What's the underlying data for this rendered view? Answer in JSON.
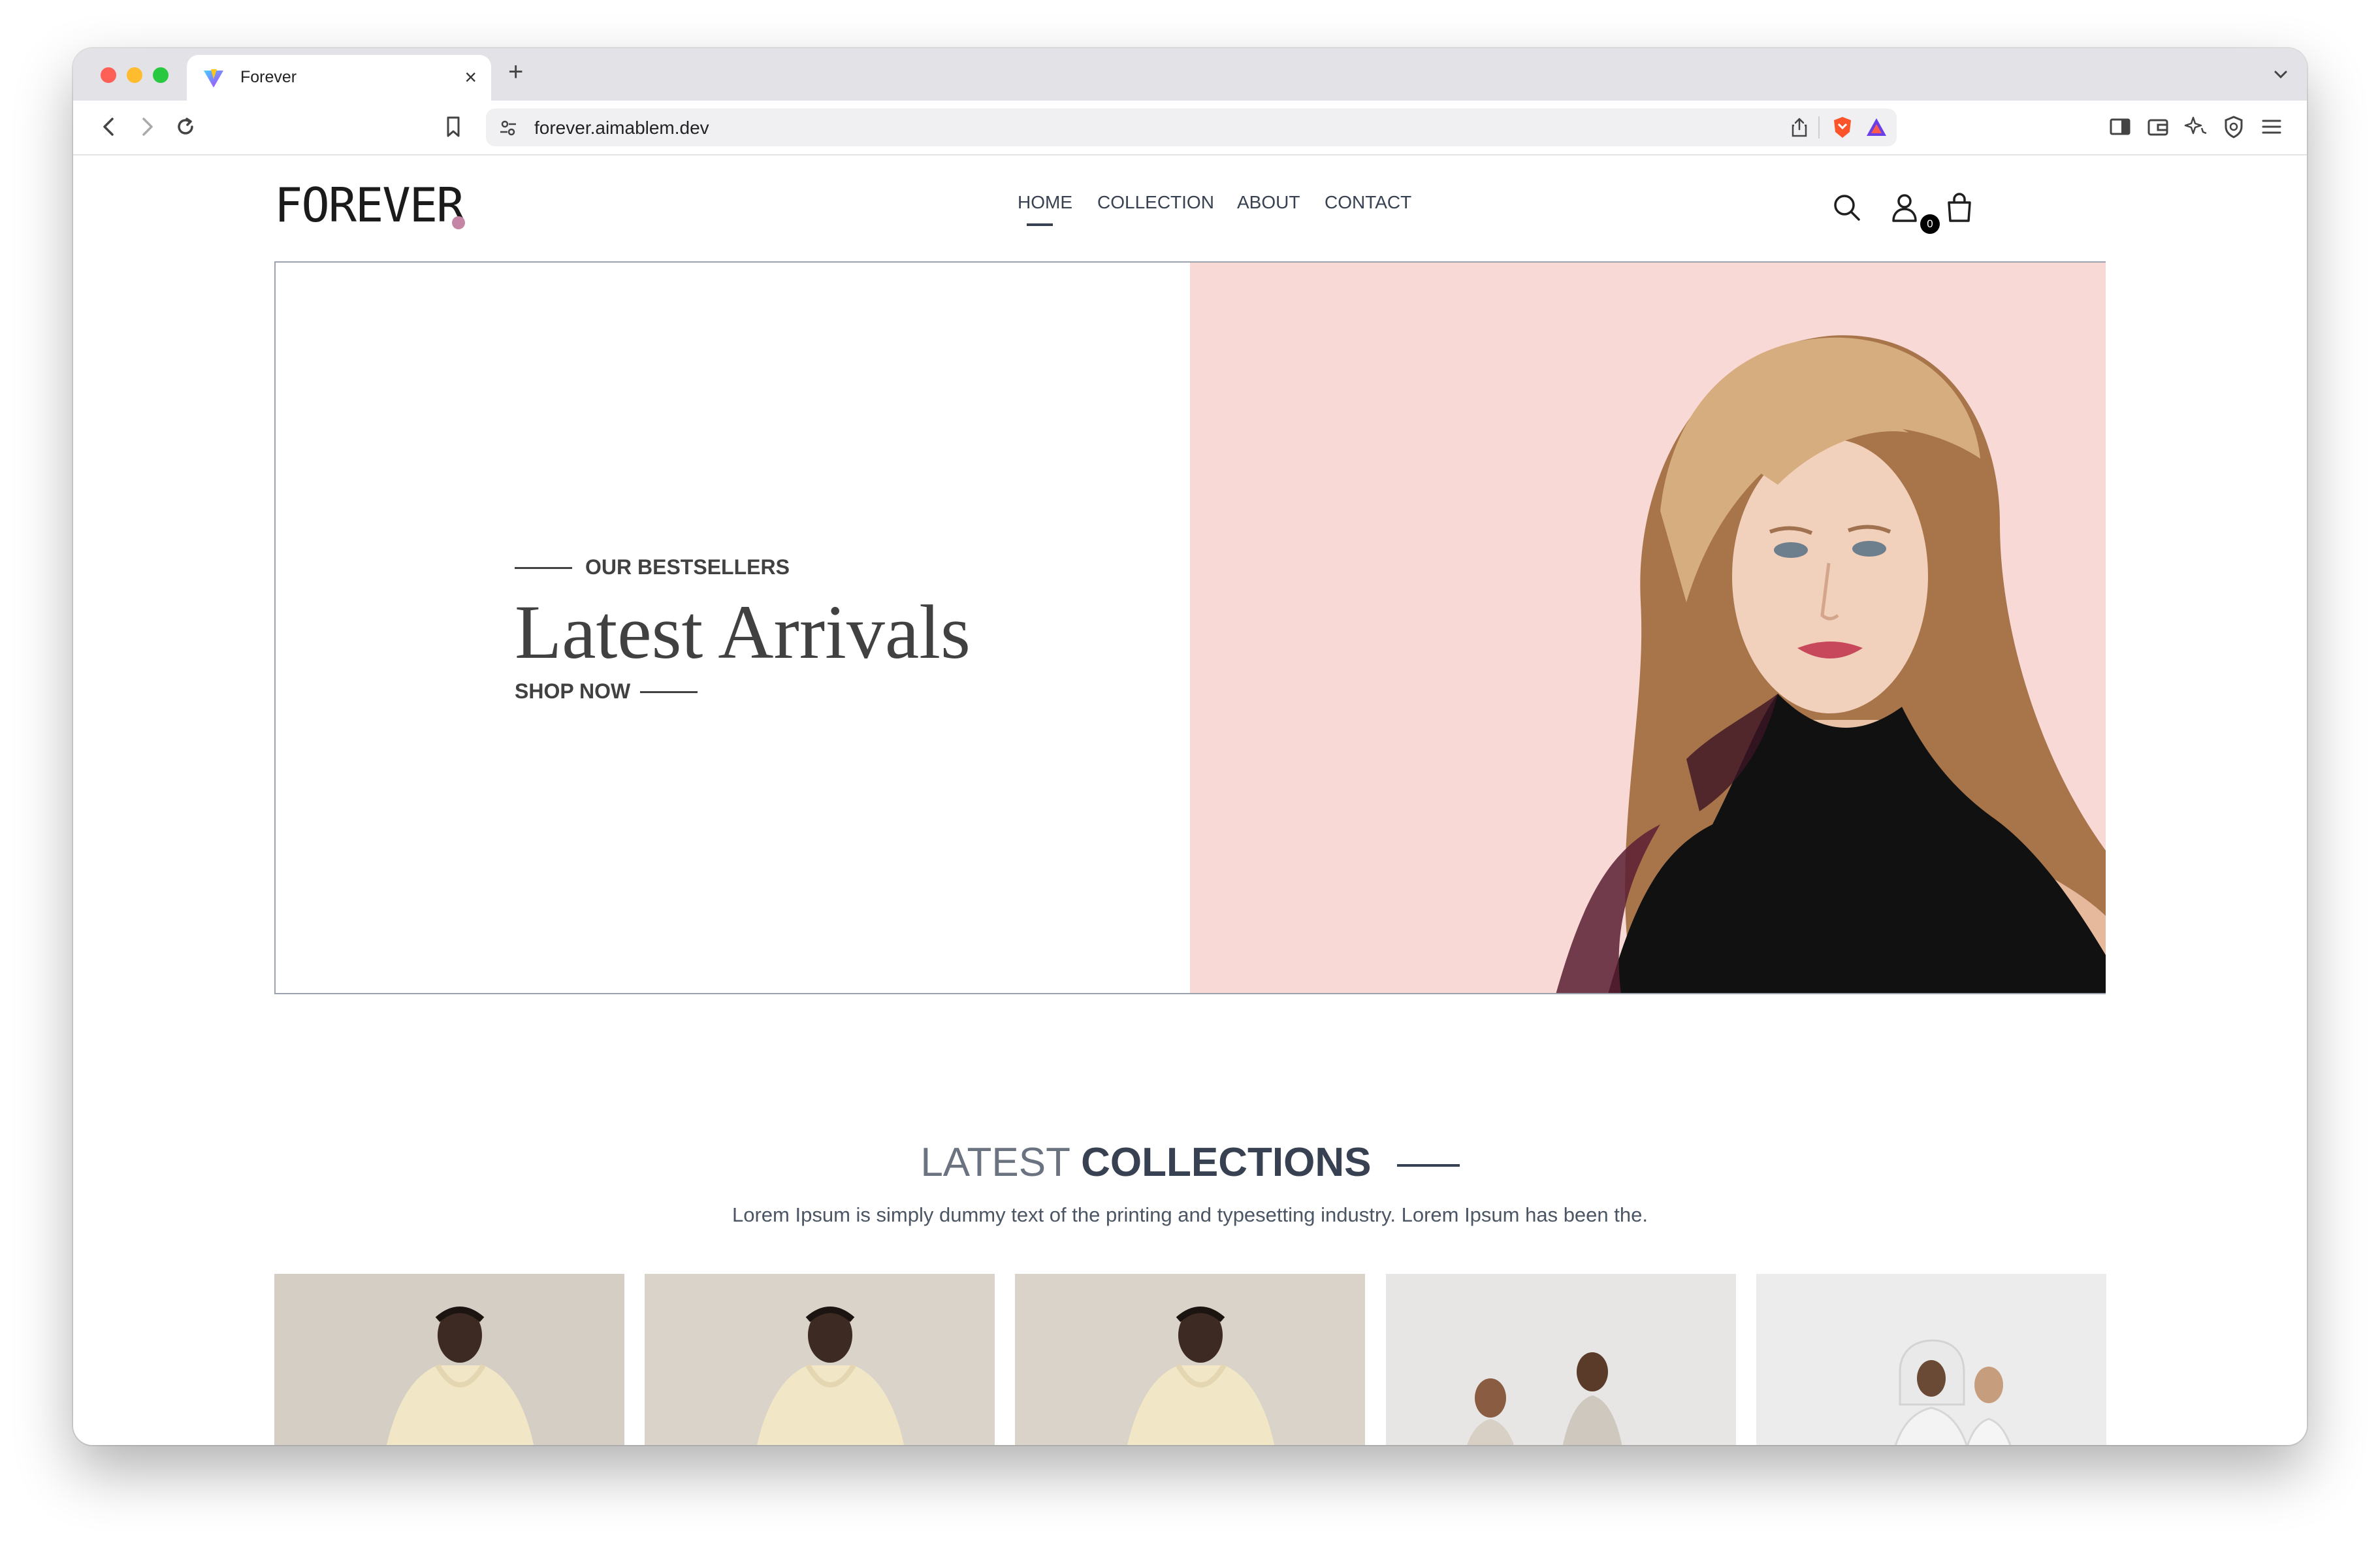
{
  "browser": {
    "tab_title": "Forever",
    "tab_close": "×",
    "new_tab": "+",
    "url": "forever.aimablem.dev"
  },
  "site": {
    "logo": "FOREVER",
    "nav": [
      "HOME",
      "COLLECTION",
      "ABOUT",
      "CONTACT"
    ],
    "active_nav": "HOME",
    "cart_count": "0"
  },
  "hero": {
    "kicker": "OUR BESTSELLERS",
    "title": "Latest Arrivals",
    "cta": "SHOP NOW"
  },
  "collections": {
    "title_light": "LATEST",
    "title_bold": "COLLECTIONS",
    "description": "Lorem Ipsum is simply dummy text of the printing and typesetting industry. Lorem Ipsum has been the."
  },
  "colors": {
    "hero_bg": "#f8d9d6",
    "logo_dot": "#c586a5",
    "text_dark": "#374151"
  },
  "icons": [
    "search-icon",
    "profile-icon",
    "cart-icon"
  ]
}
